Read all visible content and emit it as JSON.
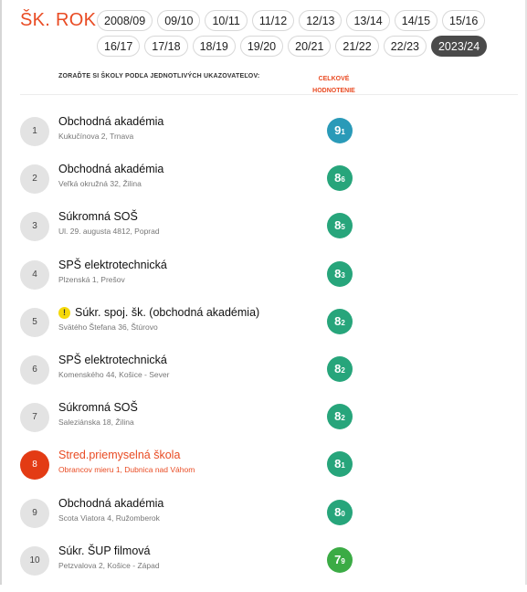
{
  "header": {
    "title": "ŠK. ROK"
  },
  "years": [
    "2008/09",
    "09/10",
    "10/11",
    "11/12",
    "12/13",
    "13/14",
    "14/15",
    "15/16",
    "16/17",
    "17/18",
    "18/19",
    "19/20",
    "20/21",
    "21/22",
    "22/23",
    "2023/24"
  ],
  "active_year": "2023/24",
  "table": {
    "sort_label": "ZORAĎTE SI ŠKOLY PODĽA JEDNOTLIVÝCH UKAZOVATEĽOV:",
    "total_label_1": "CELKOVÉ",
    "total_label_2": "HODNOTENIE"
  },
  "colors": {
    "accent": "#e94b23",
    "score_blue": "#2a9ab8",
    "score_teal": "#27a57b",
    "score_green": "#3bab45",
    "warning": "#f5d90a"
  },
  "schools": [
    {
      "rank": "1",
      "name": "Obchodná akadémia",
      "address": "Kukučínova 2, Trnava",
      "score_int": "9",
      "score_dec": "1",
      "color": "#2a9ab8",
      "warning": false,
      "highlight": false
    },
    {
      "rank": "2",
      "name": "Obchodná akadémia",
      "address": "Veľká okružná 32, Žilina",
      "score_int": "8",
      "score_dec": "6",
      "color": "#27a57b",
      "warning": false,
      "highlight": false
    },
    {
      "rank": "3",
      "name": "Súkromná SOŠ",
      "address": "Ul. 29. augusta 4812, Poprad",
      "score_int": "8",
      "score_dec": "5",
      "color": "#27a57b",
      "warning": false,
      "highlight": false
    },
    {
      "rank": "4",
      "name": "SPŠ elektrotechnická",
      "address": "Plzenská 1, Prešov",
      "score_int": "8",
      "score_dec": "3",
      "color": "#27a57b",
      "warning": false,
      "highlight": false
    },
    {
      "rank": "5",
      "name": "Súkr. spoj. šk. (obchodná akadémia)",
      "address": "Svätého Štefana 36, Štúrovo",
      "score_int": "8",
      "score_dec": "2",
      "color": "#27a57b",
      "warning": true,
      "highlight": false
    },
    {
      "rank": "6",
      "name": "SPŠ elektrotechnická",
      "address": "Komenského 44, Košice - Sever",
      "score_int": "8",
      "score_dec": "2",
      "color": "#27a57b",
      "warning": false,
      "highlight": false
    },
    {
      "rank": "7",
      "name": "Súkromná SOŠ",
      "address": "Saleziánska 18, Žilina",
      "score_int": "8",
      "score_dec": "2",
      "color": "#27a57b",
      "warning": false,
      "highlight": false
    },
    {
      "rank": "8",
      "name": "Stred.priemyselná škola",
      "address": "Obrancov mieru 1, Dubnica nad Váhom",
      "score_int": "8",
      "score_dec": "1",
      "color": "#27a57b",
      "warning": false,
      "highlight": true
    },
    {
      "rank": "9",
      "name": "Obchodná akadémia",
      "address": "Scota Viatora 4, Ružomberok",
      "score_int": "8",
      "score_dec": "0",
      "color": "#27a57b",
      "warning": false,
      "highlight": false
    },
    {
      "rank": "10",
      "name": "Súkr. ŠUP filmová",
      "address": "Petzvalova 2, Košice - Západ",
      "score_int": "7",
      "score_dec": "9",
      "color": "#3bab45",
      "warning": false,
      "highlight": false
    }
  ]
}
